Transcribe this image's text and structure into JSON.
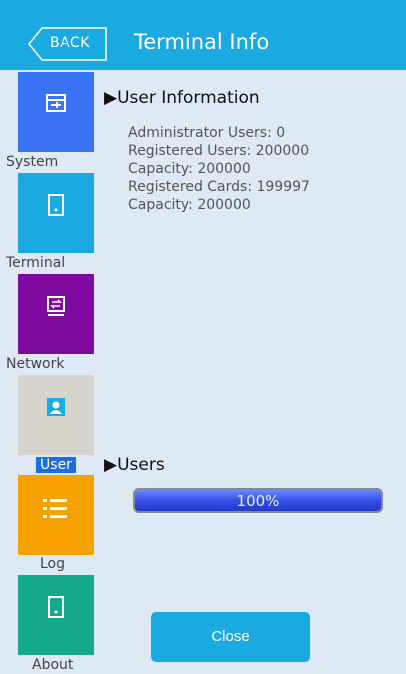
{
  "header": {
    "back_label": "BACK",
    "title": "Terminal Info",
    "color": "#1aa9e1"
  },
  "sidebar": {
    "items": [
      {
        "label": "System",
        "color": "#3b73f5",
        "icon": "system-icon"
      },
      {
        "label": "Terminal",
        "color": "#1aa9e1",
        "icon": "terminal-icon"
      },
      {
        "label": "Network",
        "color": "#7f0aa0",
        "icon": "network-icon"
      },
      {
        "label": "User",
        "color": "#d7d4cc",
        "icon": "user-icon",
        "selected": true
      },
      {
        "label": "Log",
        "color": "#f6a100",
        "icon": "log-icon"
      },
      {
        "label": "About",
        "color": "#15a98b",
        "icon": "about-icon"
      }
    ]
  },
  "user_info": {
    "title": "▶User Information",
    "lines": [
      "Administrator Users: 0",
      "Registered Users: 200000",
      "Capacity: 200000",
      "Registered Cards: 199997",
      "Capacity: 200000"
    ]
  },
  "users": {
    "title": "▶Users",
    "progress_text": "100%",
    "progress_fraction": 1.0
  },
  "footer": {
    "close_label": "Close"
  }
}
